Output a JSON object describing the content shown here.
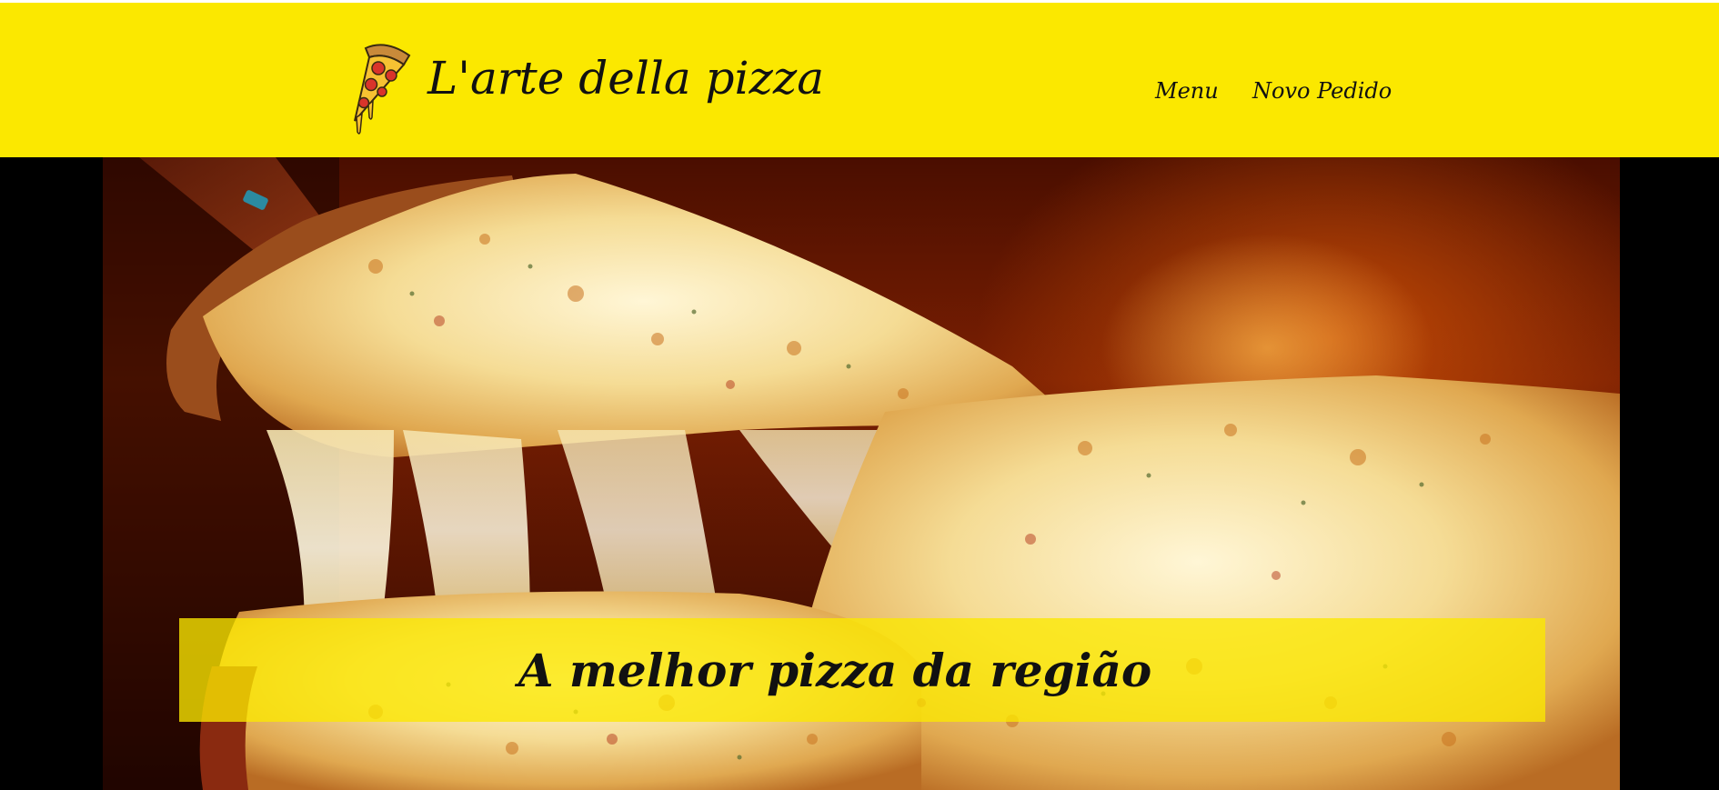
{
  "header": {
    "site_title": "L'arte della pizza",
    "logo_icon": "pizza-slice-icon",
    "background_color": "#fbe800",
    "nav": [
      {
        "label": "Menu"
      },
      {
        "label": "Novo Pedido"
      }
    ]
  },
  "hero": {
    "banner_text": "A melhor pizza da região"
  }
}
